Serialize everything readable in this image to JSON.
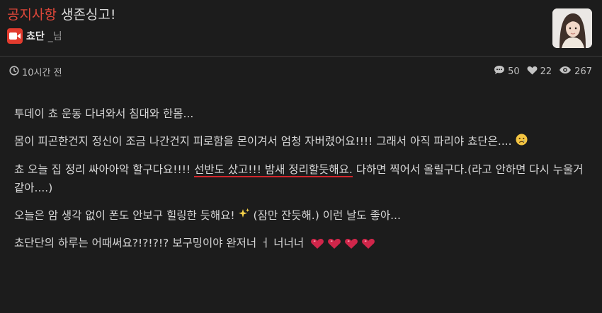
{
  "post": {
    "category": "공지사항",
    "title": "생존싱고!",
    "author_name": "쵸단",
    "author_suffix": "_님",
    "time_ago": "10시간 전",
    "comments": "50",
    "likes": "22",
    "views": "267"
  },
  "body": {
    "p1": "투데이 쵸 운동 다녀와서 침대와 한몸...",
    "p2": "몸이 피곤한건지 정신이 조금 나간건지 피로함을 몬이겨서 엄청 자버렸어요!!!! 그래서 아직 파리야 쵸단은....",
    "p3_a": "쵸 오늘 집 정리 싸아아악 할구다요!!!! ",
    "p3_b": "선반도 샀고!!! 밤새 정리할듯해요.",
    "p3_c": " 다하면 찍어서 올릴구다.(라고 안하면 다시 누울거같아....)",
    "p4_a": "오늘은 암 생각 없이 폰도 안보구 힐링한 듯해요!",
    "p4_b": "(잠만 잔듯해.) 이런 날도 좋아...",
    "p5": "쵸단단의 하루는 어때써요?!?!?!? 보구밍이야 완저너 ㅓ 너너너"
  },
  "colors": {
    "accent": "#e0473a",
    "underline": "#d3262b",
    "heart": "#d0264a"
  },
  "icons": [
    "video-icon",
    "clock-icon",
    "comment-icon",
    "heart-icon",
    "eye-icon",
    "sad-face-emoji",
    "sparkles-emoji",
    "heart-emoji"
  ]
}
